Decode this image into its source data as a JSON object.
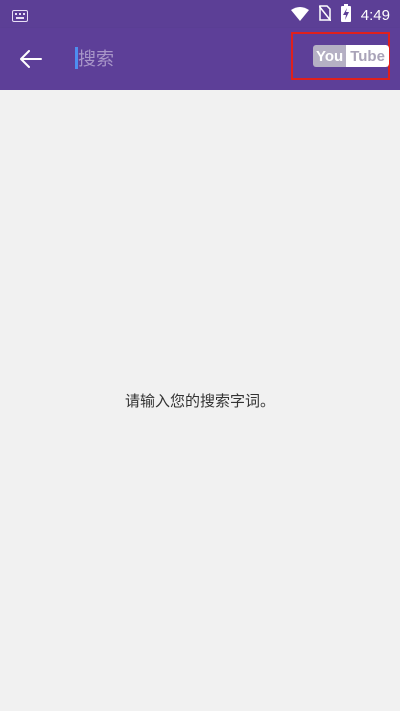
{
  "status_bar": {
    "time": "4:49",
    "icons": [
      "keyboard-icon",
      "wifi-icon",
      "no-sim-icon",
      "battery-charging-icon"
    ]
  },
  "app_bar": {
    "back_icon": "arrow-left-icon",
    "search_placeholder": "搜索",
    "logo": {
      "part1": "You",
      "part2": "Tube"
    },
    "highlight_color": "#e0201c",
    "background_color": "#5d3f98"
  },
  "content": {
    "empty_message": "请输入您的搜索字词。"
  }
}
